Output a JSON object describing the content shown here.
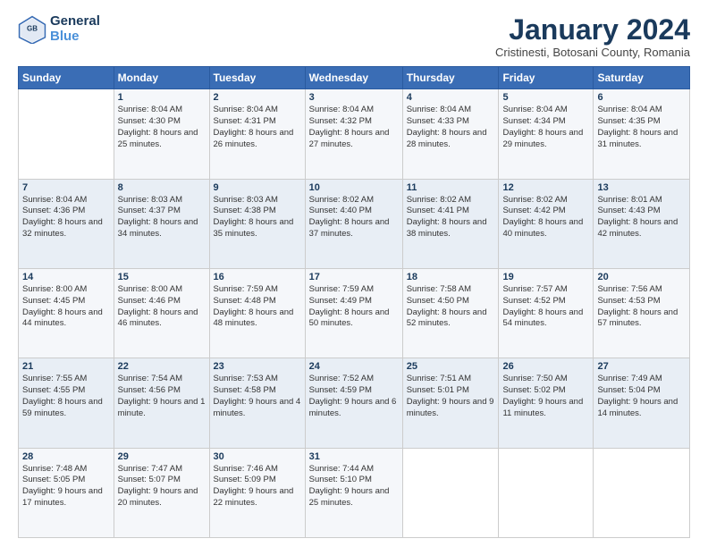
{
  "header": {
    "logo_line1": "General",
    "logo_line2": "Blue",
    "month": "January 2024",
    "location": "Cristinesti, Botosani County, Romania"
  },
  "weekdays": [
    "Sunday",
    "Monday",
    "Tuesday",
    "Wednesday",
    "Thursday",
    "Friday",
    "Saturday"
  ],
  "weeks": [
    [
      {
        "day": "",
        "sunrise": "",
        "sunset": "",
        "daylight": ""
      },
      {
        "day": "1",
        "sunrise": "Sunrise: 8:04 AM",
        "sunset": "Sunset: 4:30 PM",
        "daylight": "Daylight: 8 hours and 25 minutes."
      },
      {
        "day": "2",
        "sunrise": "Sunrise: 8:04 AM",
        "sunset": "Sunset: 4:31 PM",
        "daylight": "Daylight: 8 hours and 26 minutes."
      },
      {
        "day": "3",
        "sunrise": "Sunrise: 8:04 AM",
        "sunset": "Sunset: 4:32 PM",
        "daylight": "Daylight: 8 hours and 27 minutes."
      },
      {
        "day": "4",
        "sunrise": "Sunrise: 8:04 AM",
        "sunset": "Sunset: 4:33 PM",
        "daylight": "Daylight: 8 hours and 28 minutes."
      },
      {
        "day": "5",
        "sunrise": "Sunrise: 8:04 AM",
        "sunset": "Sunset: 4:34 PM",
        "daylight": "Daylight: 8 hours and 29 minutes."
      },
      {
        "day": "6",
        "sunrise": "Sunrise: 8:04 AM",
        "sunset": "Sunset: 4:35 PM",
        "daylight": "Daylight: 8 hours and 31 minutes."
      }
    ],
    [
      {
        "day": "7",
        "sunrise": "Sunrise: 8:04 AM",
        "sunset": "Sunset: 4:36 PM",
        "daylight": "Daylight: 8 hours and 32 minutes."
      },
      {
        "day": "8",
        "sunrise": "Sunrise: 8:03 AM",
        "sunset": "Sunset: 4:37 PM",
        "daylight": "Daylight: 8 hours and 34 minutes."
      },
      {
        "day": "9",
        "sunrise": "Sunrise: 8:03 AM",
        "sunset": "Sunset: 4:38 PM",
        "daylight": "Daylight: 8 hours and 35 minutes."
      },
      {
        "day": "10",
        "sunrise": "Sunrise: 8:02 AM",
        "sunset": "Sunset: 4:40 PM",
        "daylight": "Daylight: 8 hours and 37 minutes."
      },
      {
        "day": "11",
        "sunrise": "Sunrise: 8:02 AM",
        "sunset": "Sunset: 4:41 PM",
        "daylight": "Daylight: 8 hours and 38 minutes."
      },
      {
        "day": "12",
        "sunrise": "Sunrise: 8:02 AM",
        "sunset": "Sunset: 4:42 PM",
        "daylight": "Daylight: 8 hours and 40 minutes."
      },
      {
        "day": "13",
        "sunrise": "Sunrise: 8:01 AM",
        "sunset": "Sunset: 4:43 PM",
        "daylight": "Daylight: 8 hours and 42 minutes."
      }
    ],
    [
      {
        "day": "14",
        "sunrise": "Sunrise: 8:00 AM",
        "sunset": "Sunset: 4:45 PM",
        "daylight": "Daylight: 8 hours and 44 minutes."
      },
      {
        "day": "15",
        "sunrise": "Sunrise: 8:00 AM",
        "sunset": "Sunset: 4:46 PM",
        "daylight": "Daylight: 8 hours and 46 minutes."
      },
      {
        "day": "16",
        "sunrise": "Sunrise: 7:59 AM",
        "sunset": "Sunset: 4:48 PM",
        "daylight": "Daylight: 8 hours and 48 minutes."
      },
      {
        "day": "17",
        "sunrise": "Sunrise: 7:59 AM",
        "sunset": "Sunset: 4:49 PM",
        "daylight": "Daylight: 8 hours and 50 minutes."
      },
      {
        "day": "18",
        "sunrise": "Sunrise: 7:58 AM",
        "sunset": "Sunset: 4:50 PM",
        "daylight": "Daylight: 8 hours and 52 minutes."
      },
      {
        "day": "19",
        "sunrise": "Sunrise: 7:57 AM",
        "sunset": "Sunset: 4:52 PM",
        "daylight": "Daylight: 8 hours and 54 minutes."
      },
      {
        "day": "20",
        "sunrise": "Sunrise: 7:56 AM",
        "sunset": "Sunset: 4:53 PM",
        "daylight": "Daylight: 8 hours and 57 minutes."
      }
    ],
    [
      {
        "day": "21",
        "sunrise": "Sunrise: 7:55 AM",
        "sunset": "Sunset: 4:55 PM",
        "daylight": "Daylight: 8 hours and 59 minutes."
      },
      {
        "day": "22",
        "sunrise": "Sunrise: 7:54 AM",
        "sunset": "Sunset: 4:56 PM",
        "daylight": "Daylight: 9 hours and 1 minute."
      },
      {
        "day": "23",
        "sunrise": "Sunrise: 7:53 AM",
        "sunset": "Sunset: 4:58 PM",
        "daylight": "Daylight: 9 hours and 4 minutes."
      },
      {
        "day": "24",
        "sunrise": "Sunrise: 7:52 AM",
        "sunset": "Sunset: 4:59 PM",
        "daylight": "Daylight: 9 hours and 6 minutes."
      },
      {
        "day": "25",
        "sunrise": "Sunrise: 7:51 AM",
        "sunset": "Sunset: 5:01 PM",
        "daylight": "Daylight: 9 hours and 9 minutes."
      },
      {
        "day": "26",
        "sunrise": "Sunrise: 7:50 AM",
        "sunset": "Sunset: 5:02 PM",
        "daylight": "Daylight: 9 hours and 11 minutes."
      },
      {
        "day": "27",
        "sunrise": "Sunrise: 7:49 AM",
        "sunset": "Sunset: 5:04 PM",
        "daylight": "Daylight: 9 hours and 14 minutes."
      }
    ],
    [
      {
        "day": "28",
        "sunrise": "Sunrise: 7:48 AM",
        "sunset": "Sunset: 5:05 PM",
        "daylight": "Daylight: 9 hours and 17 minutes."
      },
      {
        "day": "29",
        "sunrise": "Sunrise: 7:47 AM",
        "sunset": "Sunset: 5:07 PM",
        "daylight": "Daylight: 9 hours and 20 minutes."
      },
      {
        "day": "30",
        "sunrise": "Sunrise: 7:46 AM",
        "sunset": "Sunset: 5:09 PM",
        "daylight": "Daylight: 9 hours and 22 minutes."
      },
      {
        "day": "31",
        "sunrise": "Sunrise: 7:44 AM",
        "sunset": "Sunset: 5:10 PM",
        "daylight": "Daylight: 9 hours and 25 minutes."
      },
      {
        "day": "",
        "sunrise": "",
        "sunset": "",
        "daylight": ""
      },
      {
        "day": "",
        "sunrise": "",
        "sunset": "",
        "daylight": ""
      },
      {
        "day": "",
        "sunrise": "",
        "sunset": "",
        "daylight": ""
      }
    ]
  ]
}
